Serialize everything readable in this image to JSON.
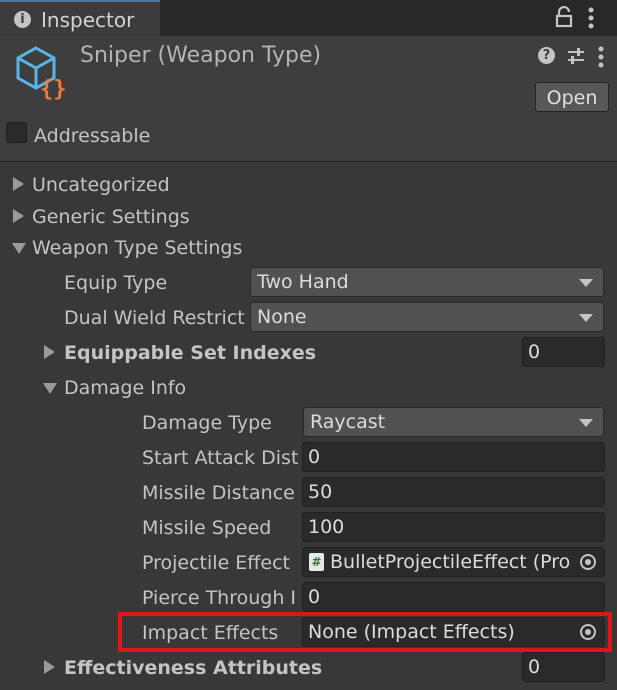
{
  "tab": {
    "icon": "info-icon",
    "label": "Inspector"
  },
  "header": {
    "title": "Sniper (Weapon Type)",
    "open_button": "Open",
    "addressable_label": "Addressable",
    "addressable_checked": false
  },
  "sections": {
    "uncategorized": "Uncategorized",
    "generic_settings": "Generic Settings",
    "weapon_type_settings": "Weapon Type Settings"
  },
  "fields": {
    "equip_type": {
      "label": "Equip Type",
      "value": "Two Hand"
    },
    "dual_wield": {
      "label": "Dual Wield Restrict",
      "value": "None"
    },
    "equippable_set": {
      "label": "Equippable Set Indexes",
      "value": "0"
    },
    "damage_info": "Damage Info",
    "damage_type": {
      "label": "Damage Type",
      "value": "Raycast"
    },
    "start_attack": {
      "label": "Start Attack Dist",
      "value": "0"
    },
    "missile_distance": {
      "label": "Missile Distance",
      "value": "50"
    },
    "missile_speed": {
      "label": "Missile Speed",
      "value": "100"
    },
    "projectile_effect": {
      "label": "Projectile Effect",
      "value": "BulletProjectileEffect (Pro"
    },
    "pierce_through": {
      "label": "Pierce Through I",
      "value": "0"
    },
    "impact_effects": {
      "label": "Impact Effects",
      "value": "None (Impact Effects)"
    },
    "effectiveness": {
      "label": "Effectiveness Attributes",
      "value": "0"
    }
  },
  "colors": {
    "highlight": "#e01616",
    "tab_accent": "#3a79bb",
    "background": "#383838"
  }
}
